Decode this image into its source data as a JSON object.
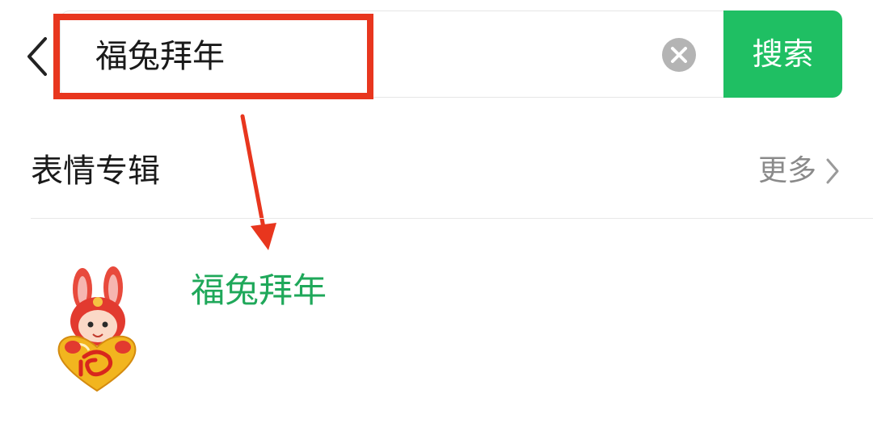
{
  "search": {
    "query": "福兔拜年",
    "button_label": "搜索"
  },
  "section": {
    "title": "表情专辑",
    "more_label": "更多"
  },
  "results": [
    {
      "title": "福兔拜年",
      "thumbnail_icon": "rabbit-sticker-icon"
    }
  ],
  "colors": {
    "accent": "#1fbf63",
    "result_title": "#1fa85a",
    "annotation": "#e8361e"
  }
}
